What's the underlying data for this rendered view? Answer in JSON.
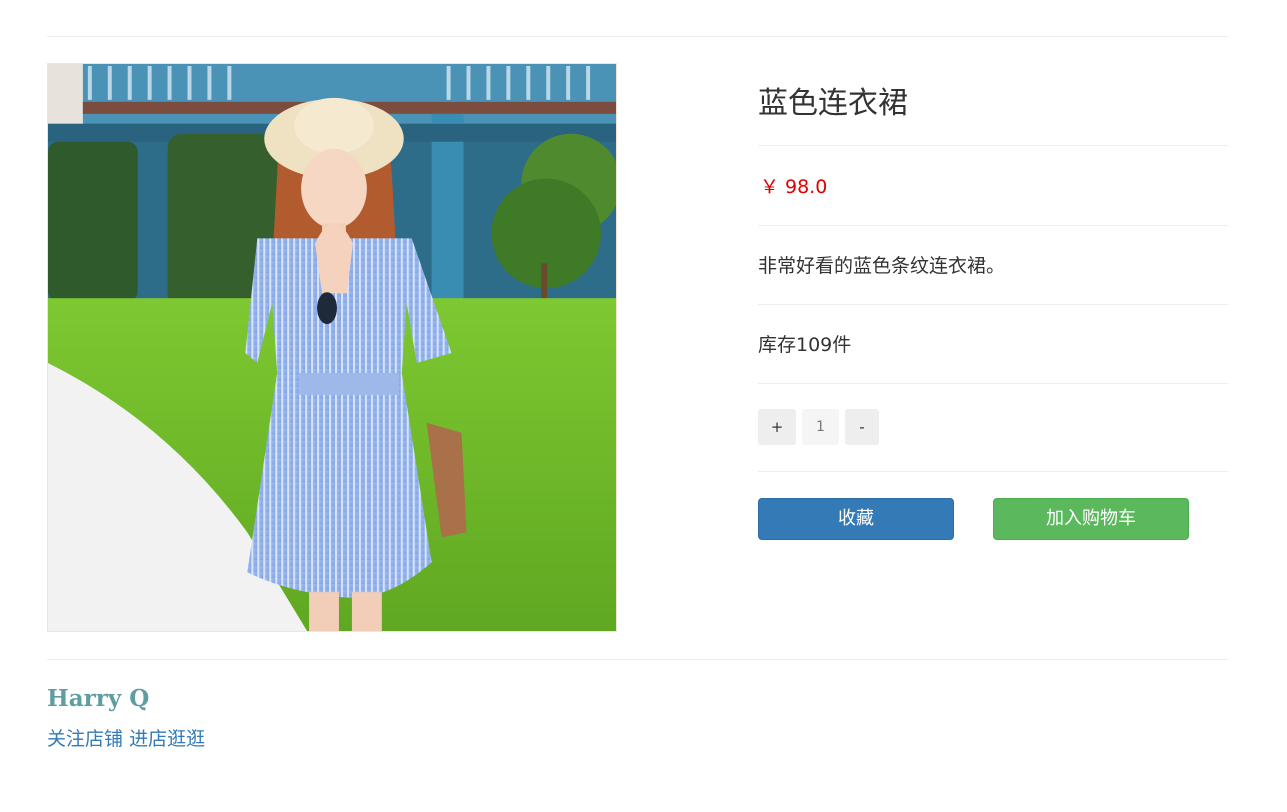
{
  "product": {
    "title": "蓝色连衣裙",
    "price": "￥ 98.0",
    "description": "非常好看的蓝色条纹连衣裙。",
    "stock": "库存109件",
    "image_alt": "blue striped dress photo"
  },
  "quantity": {
    "plus_label": "+",
    "value": "1",
    "minus_label": "-"
  },
  "actions": {
    "favorite_label": "收藏",
    "add_to_cart_label": "加入购物车"
  },
  "shop": {
    "name": "Harry Q",
    "follow_label": "关注店铺",
    "visit_label": "进店逛逛"
  },
  "colors": {
    "price": "#e00000",
    "favorite_button": "#337ab7",
    "cart_button": "#5cb85c",
    "shop_name": "#5f9ea0",
    "link": "#337ab7"
  }
}
